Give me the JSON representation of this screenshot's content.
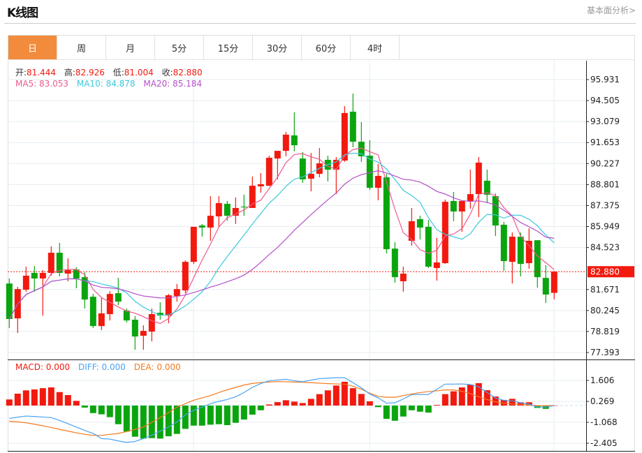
{
  "header": {
    "title": "K线图",
    "link": "基本面分析>"
  },
  "tabs": [
    {
      "label": "日",
      "active": true
    },
    {
      "label": "周"
    },
    {
      "label": "月"
    },
    {
      "label": "5分"
    },
    {
      "label": "15分"
    },
    {
      "label": "30分"
    },
    {
      "label": "60分"
    },
    {
      "label": "4时"
    }
  ],
  "info": {
    "open_label": "开:",
    "open": "81.444",
    "high_label": "高:",
    "high": "82.926",
    "low_label": "低:",
    "low": "81.004",
    "close_label": "收:",
    "close": "82.880",
    "ma5": "MA5: 83.053",
    "ma10": "MA10: 84.878",
    "ma20": "MA20: 85.184",
    "macd": "MACD: 0.000",
    "diff": "DIFF: 0.000",
    "dea": "DEA: 0.000"
  },
  "colors": {
    "up": "#f2190e",
    "down": "#0aa50e",
    "ma5": "#ee5a8f",
    "ma10": "#3cc8dc",
    "ma20": "#b44fc8",
    "diff": "#4aa3f0",
    "dea": "#f47a1f",
    "accent": "#f28c3c"
  },
  "chart_data": {
    "type": "candlestick",
    "price_axis": {
      "ticks": [
        "95.931",
        "94.505",
        "93.079",
        "91.653",
        "90.227",
        "88.801",
        "87.375",
        "85.949",
        "84.523",
        "81.671",
        "80.245",
        "78.819",
        "77.393"
      ],
      "range": [
        77.393,
        95.931
      ]
    },
    "last_price": "82.880",
    "candles": [
      [
        82.08,
        82.42,
        79.05,
        79.67
      ],
      [
        79.71,
        81.85,
        78.72,
        81.7
      ],
      [
        81.66,
        83.22,
        81.52,
        82.61
      ],
      [
        82.8,
        83.27,
        81.52,
        82.42
      ],
      [
        82.42,
        82.99,
        79.9,
        82.8
      ],
      [
        82.8,
        84.6,
        82.61,
        84.17
      ],
      [
        84.17,
        84.84,
        82.56,
        82.8
      ],
      [
        82.75,
        83.79,
        82.23,
        82.99
      ],
      [
        83.03,
        83.18,
        81.75,
        82.42
      ],
      [
        82.51,
        82.84,
        80.38,
        80.99
      ],
      [
        81.18,
        81.37,
        79.05,
        79.19
      ],
      [
        79.19,
        81.09,
        78.91,
        80.05
      ],
      [
        80.0,
        81.56,
        79.57,
        81.37
      ],
      [
        81.42,
        82.46,
        80.61,
        80.85
      ],
      [
        80.24,
        80.38,
        79.43,
        79.57
      ],
      [
        79.62,
        79.86,
        77.58,
        78.48
      ],
      [
        78.53,
        79.24,
        77.58,
        78.86
      ],
      [
        78.81,
        80.38,
        78.15,
        80.0
      ],
      [
        80.09,
        80.8,
        79.62,
        79.9
      ],
      [
        79.9,
        81.37,
        79.38,
        81.28
      ],
      [
        81.23,
        82.04,
        80.85,
        81.7
      ],
      [
        81.61,
        83.65,
        81.42,
        83.55
      ],
      [
        83.55,
        85.93,
        83.41,
        85.93
      ],
      [
        86.02,
        86.12,
        85.26,
        85.88
      ],
      [
        85.88,
        88.01,
        84.98,
        86.68
      ],
      [
        86.64,
        88.01,
        85.93,
        87.54
      ],
      [
        87.49,
        87.68,
        86.35,
        86.68
      ],
      [
        86.68,
        87.92,
        86.12,
        87.21
      ],
      [
        87.3,
        88.11,
        86.68,
        87.25
      ],
      [
        87.21,
        89.34,
        87.21,
        88.72
      ],
      [
        88.68,
        89.58,
        88.25,
        88.82
      ],
      [
        88.72,
        90.76,
        88.68,
        90.62
      ],
      [
        90.57,
        91.09,
        89.15,
        91.09
      ],
      [
        91.09,
        92.38,
        90.72,
        92.19
      ],
      [
        92.14,
        93.7,
        91.05,
        91.47
      ],
      [
        90.57,
        91.0,
        88.91,
        89.15
      ],
      [
        89.2,
        90.95,
        88.34,
        89.53
      ],
      [
        89.53,
        91.28,
        89.29,
        90.24
      ],
      [
        90.48,
        90.76,
        89.01,
        89.81
      ],
      [
        89.81,
        90.67,
        88.15,
        90.48
      ],
      [
        90.43,
        94.13,
        90.34,
        93.66
      ],
      [
        93.75,
        94.98,
        91.33,
        91.71
      ],
      [
        91.71,
        93.04,
        90.34,
        90.72
      ],
      [
        90.76,
        91.81,
        88.44,
        88.58
      ],
      [
        88.58,
        90.19,
        87.73,
        89.39
      ],
      [
        89.29,
        89.53,
        84.12,
        84.41
      ],
      [
        84.45,
        84.88,
        82.13,
        82.51
      ],
      [
        82.23,
        83.22,
        81.52,
        82.75
      ],
      [
        84.98,
        87.21,
        84.65,
        86.31
      ],
      [
        86.45,
        86.68,
        85.07,
        85.88
      ],
      [
        85.93,
        86.4,
        83.13,
        83.22
      ],
      [
        83.13,
        85.17,
        82.27,
        83.51
      ],
      [
        83.46,
        87.78,
        83.41,
        87.63
      ],
      [
        87.68,
        88.3,
        86.31,
        86.97
      ],
      [
        86.97,
        87.68,
        85.59,
        87.68
      ],
      [
        87.68,
        89.81,
        87.16,
        88.15
      ],
      [
        88.15,
        90.67,
        86.59,
        90.29
      ],
      [
        89.06,
        89.81,
        87.54,
        88.11
      ],
      [
        88.01,
        88.2,
        85.31,
        86.02
      ],
      [
        86.07,
        86.26,
        82.94,
        83.6
      ],
      [
        83.55,
        85.55,
        82.08,
        85.26
      ],
      [
        85.26,
        85.55,
        82.56,
        83.41
      ],
      [
        83.46,
        85.83,
        83.08,
        84.98
      ],
      [
        85.02,
        85.02,
        81.8,
        82.51
      ],
      [
        82.46,
        83.32,
        80.76,
        81.33
      ],
      [
        81.444,
        82.926,
        81.004,
        82.88
      ]
    ],
    "candle_fields": [
      "open",
      "high",
      "low",
      "close"
    ],
    "macd_axis": {
      "ticks": [
        "1.606",
        "0.269",
        "-1.068",
        "-2.405"
      ],
      "range": [
        -2.405,
        1.606
      ]
    },
    "macd": [
      0.39,
      0.76,
      0.97,
      1.03,
      1.11,
      1.16,
      0.86,
      0.67,
      0.3,
      -0.13,
      -0.48,
      -0.56,
      -0.74,
      -1.19,
      -1.66,
      -1.99,
      -2.11,
      -2.08,
      -2.11,
      -1.96,
      -1.81,
      -1.49,
      -1.28,
      -1.28,
      -1.22,
      -1.19,
      -1.25,
      -1.1,
      -0.89,
      -0.58,
      -0.3,
      0.07,
      0.22,
      0.34,
      0.25,
      0.16,
      0.43,
      0.73,
      0.97,
      1.28,
      1.52,
      1.11,
      0.74,
      0.27,
      -0.1,
      -0.85,
      -0.97,
      -0.7,
      -0.3,
      -0.39,
      -0.45,
      0.04,
      0.73,
      0.91,
      1.16,
      1.34,
      1.43,
      0.98,
      0.58,
      0.36,
      0.43,
      0.21,
      0.21,
      -0.15,
      -0.21,
      0
    ],
    "diff": [
      -0.82,
      -0.74,
      -0.67,
      -0.7,
      -0.73,
      -0.77,
      -0.95,
      -1.16,
      -1.37,
      -1.59,
      -1.78,
      -2.11,
      -2.14,
      -2.26,
      -2.35,
      -2.29,
      -2.11,
      -1.89,
      -1.63,
      -1.37,
      -1.04,
      -0.59,
      -0.3,
      -0.1,
      0.12,
      0.27,
      0.39,
      0.56,
      0.83,
      1.16,
      1.41,
      1.58,
      1.63,
      1.68,
      1.58,
      1.52,
      1.63,
      1.72,
      1.75,
      1.78,
      1.78,
      1.46,
      1.13,
      0.74,
      0.49,
      0.15,
      0.18,
      0.42,
      0.7,
      0.71,
      0.71,
      1.04,
      1.37,
      1.37,
      1.38,
      1.34,
      1.19,
      0.83,
      0.49,
      0.33,
      0.3,
      0.18,
      0.09,
      -0.09,
      -0.1,
      0
    ],
    "dea": [
      -1.0,
      -1.04,
      -1.1,
      -1.19,
      -1.29,
      -1.4,
      -1.52,
      -1.63,
      -1.74,
      -1.84,
      -1.9,
      -1.9,
      -1.84,
      -1.78,
      -1.66,
      -1.52,
      -1.37,
      -1.07,
      -0.77,
      -0.45,
      -0.1,
      0.12,
      0.34,
      0.49,
      0.64,
      0.83,
      1.01,
      1.16,
      1.31,
      1.41,
      1.47,
      1.5,
      1.53,
      1.52,
      1.5,
      1.49,
      1.46,
      1.43,
      1.4,
      1.38,
      1.37,
      1.23,
      1.04,
      0.79,
      0.59,
      0.53,
      0.53,
      0.64,
      0.74,
      0.83,
      0.89,
      0.94,
      1.0,
      1.0,
      0.91,
      0.76,
      0.56,
      0.39,
      0.24,
      0.15,
      0.1,
      0.07,
      0.03,
      -0.01,
      -0.01,
      0
    ],
    "grid": true
  }
}
